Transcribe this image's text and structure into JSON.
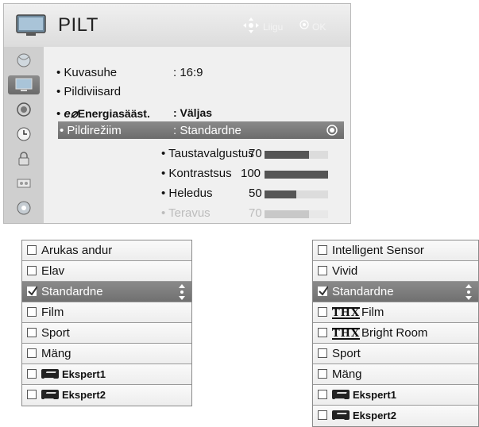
{
  "menu": {
    "title": "PILT",
    "hint_move": "Liigu",
    "hint_ok": "OK",
    "sidebar": [
      {
        "icon": "globe-disc-icon",
        "active": false
      },
      {
        "icon": "tv-screen-icon",
        "active": true
      },
      {
        "icon": "speaker-icon",
        "active": false
      },
      {
        "icon": "clock-icon",
        "active": false
      },
      {
        "icon": "lock-icon",
        "active": false
      },
      {
        "icon": "input-icon",
        "active": false
      },
      {
        "icon": "support-icon",
        "active": false
      }
    ],
    "rows": [
      {
        "label": "Kuvasuhe",
        "value": ": 16:9"
      },
      {
        "label": "Pildiviisard",
        "value": ""
      },
      {
        "label": "Energiasääst.",
        "value": ": Väljas"
      },
      {
        "label": "Pildirežiim",
        "value": ": Standardne",
        "selected": true
      }
    ],
    "sub_items": [
      {
        "label": "• Taustavalgustus",
        "value": "70",
        "level": 0.7
      },
      {
        "label": "• Kontrastsus",
        "value": "100",
        "level": 1.0
      },
      {
        "label": "• Heledus",
        "value": "50",
        "level": 0.5
      },
      {
        "label": "• Teravus",
        "value": "70",
        "level": 0.7,
        "dimmed": true
      }
    ]
  },
  "list_left": {
    "items": [
      {
        "label": "Arukas andur",
        "checked": false
      },
      {
        "label": "Elav",
        "checked": false
      },
      {
        "label": "Standardne",
        "checked": true,
        "selected": true
      },
      {
        "label": "Film",
        "checked": false
      },
      {
        "label": "Sport",
        "checked": false
      },
      {
        "label": "Mäng",
        "checked": false
      },
      {
        "label": "Ekspert1",
        "checked": false,
        "isf": true
      },
      {
        "label": "Ekspert2",
        "checked": false,
        "isf": true
      }
    ]
  },
  "list_right": {
    "items": [
      {
        "label": "Intelligent Sensor",
        "checked": false
      },
      {
        "label": "Vivid",
        "checked": false
      },
      {
        "label": "Standardne",
        "checked": true,
        "selected": true
      },
      {
        "label": "Film",
        "checked": false,
        "thx": "THX"
      },
      {
        "label": "Bright Room",
        "checked": false,
        "thx": "THX"
      },
      {
        "label": "Sport",
        "checked": false
      },
      {
        "label": "Mäng",
        "checked": false
      },
      {
        "label": "Ekspert1",
        "checked": false,
        "isf": true
      },
      {
        "label": "Ekspert2",
        "checked": false,
        "isf": true
      }
    ]
  }
}
